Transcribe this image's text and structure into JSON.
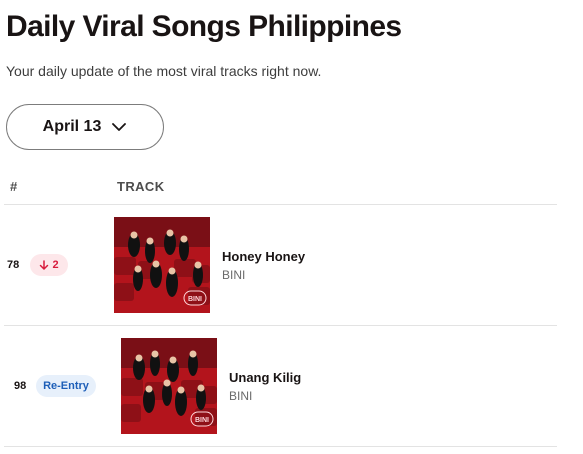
{
  "page": {
    "title": "Daily Viral Songs Philippines",
    "subtitle": "Your daily update of the most viral tracks right now."
  },
  "date_selector": {
    "label": "April 13",
    "icon": "chevron-down-icon"
  },
  "table": {
    "headers": {
      "rank": "#",
      "track": "TRACK"
    },
    "rows": [
      {
        "rank": "78",
        "movement": {
          "type": "down",
          "icon": "arrow-down-icon",
          "value": "2"
        },
        "title": "Honey Honey",
        "artist": "BINI",
        "cover_logo": "BINI"
      },
      {
        "rank": "98",
        "movement": {
          "type": "re-entry",
          "label": "Re-Entry"
        },
        "title": "Unang Kilig",
        "artist": "BINI",
        "cover_logo": "BINI"
      }
    ]
  },
  "colors": {
    "text": "#191414",
    "down": "#d81b3c",
    "down_bg": "#fde7ea",
    "reentry": "#1e5fb8",
    "reentry_bg": "#e7f0fb",
    "cover_red": "#b3141c"
  }
}
